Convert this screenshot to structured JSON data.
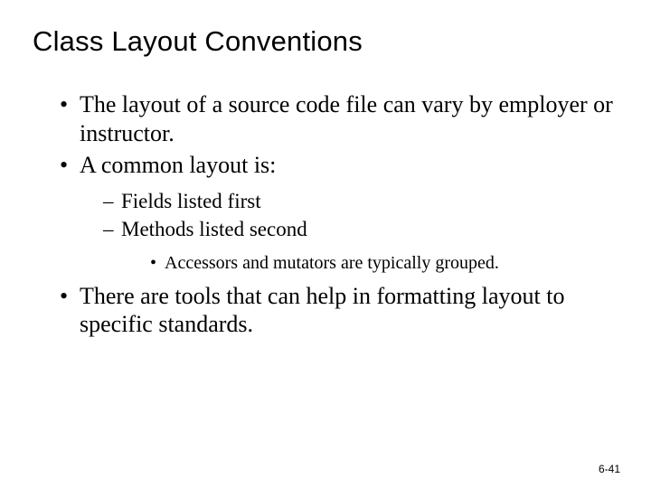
{
  "title": "Class Layout Conventions",
  "bullets": {
    "b0": "The layout of a source code file can vary by employer or instructor.",
    "b1": "A common layout is:",
    "b1_sub": {
      "s0": "Fields listed first",
      "s1": "Methods listed second",
      "s1_sub": {
        "t0": "Accessors and mutators are typically grouped."
      }
    },
    "b2": "There are tools that can help in formatting layout to specific standards."
  },
  "footer": "6-41"
}
